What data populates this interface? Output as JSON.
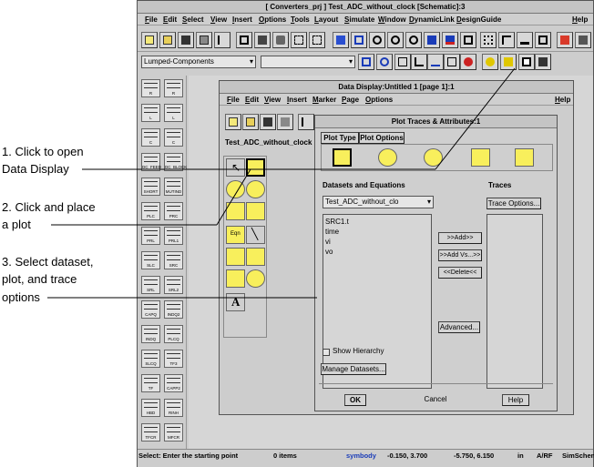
{
  "main_window": {
    "title": "[ Converters_prj ] Test_ADC_without_clock [Schematic]:3",
    "menu": [
      "File",
      "Edit",
      "Select",
      "View",
      "Insert",
      "Options",
      "Tools",
      "Layout",
      "Simulate",
      "Window",
      "DynamicLink",
      "DesignGuide",
      "Help"
    ],
    "palette_select": "Lumped-Components",
    "palette_items": [
      {
        "left": "R",
        "right": "R"
      },
      {
        "left": "L",
        "right": "L"
      },
      {
        "left": "C",
        "right": "C"
      },
      {
        "left": "DC_FEED",
        "right": "DC_BLOCK"
      },
      {
        "left": "SHORT",
        "right": "MUTIND"
      },
      {
        "left": "PLC",
        "right": "PRC"
      },
      {
        "left": "PRL",
        "right": "PRL1"
      },
      {
        "left": "SLC",
        "right": "SRC"
      },
      {
        "left": "SRL",
        "right": "SRL2"
      },
      {
        "left": "CAPQ",
        "right": "INDQ2"
      },
      {
        "left": "INDQ",
        "right": "PLCQ"
      },
      {
        "left": "SLCQ",
        "right": "TF3"
      },
      {
        "left": "TF",
        "right": "CAPP2"
      },
      {
        "left": "HBD",
        "right": "RINH"
      },
      {
        "left": "TFCR",
        "right": "MFCR"
      }
    ],
    "status": {
      "message": "Select: Enter the starting point",
      "items": "0 items",
      "layer": "symbody",
      "coord1": "-0.150, 3.700",
      "coord2": "-5.750, 6.150",
      "unit": "in",
      "mode": "A/RF",
      "view": "SimSchen"
    }
  },
  "data_display": {
    "title": "Data Display:Untitled 1 [page 1]:1",
    "menu": [
      "File",
      "Edit",
      "View",
      "Insert",
      "Marker",
      "Page",
      "Options",
      "Help"
    ],
    "default_dataset": "Test_ADC_without_clock"
  },
  "plot_dialog": {
    "title": "Plot Traces & Attributes:1",
    "tabs": [
      "Plot Type",
      "Plot Options"
    ],
    "datasets_label": "Datasets and Equations",
    "traces_label": "Traces",
    "dataset_select": "Test_ADC_without_clo",
    "variables": [
      "SRC1.t",
      "time",
      "vi",
      "vo"
    ],
    "trace_options": "Trace Options...",
    "add": ">>Add>>",
    "add_vs": ">>Add Vs...>>",
    "delete": "<<Delete<<",
    "advanced": "Advanced...",
    "show_hierarchy": "Show Hierarchy",
    "manage_datasets": "Manage Datasets...",
    "ok": "OK",
    "cancel": "Cancel",
    "help": "Help"
  },
  "annotations": {
    "step1": [
      "1. Click to open",
      "Data Display"
    ],
    "step2": [
      "2. Click and place",
      "a plot"
    ],
    "step3": [
      "3. Select dataset,",
      "plot, and trace",
      "options"
    ]
  }
}
